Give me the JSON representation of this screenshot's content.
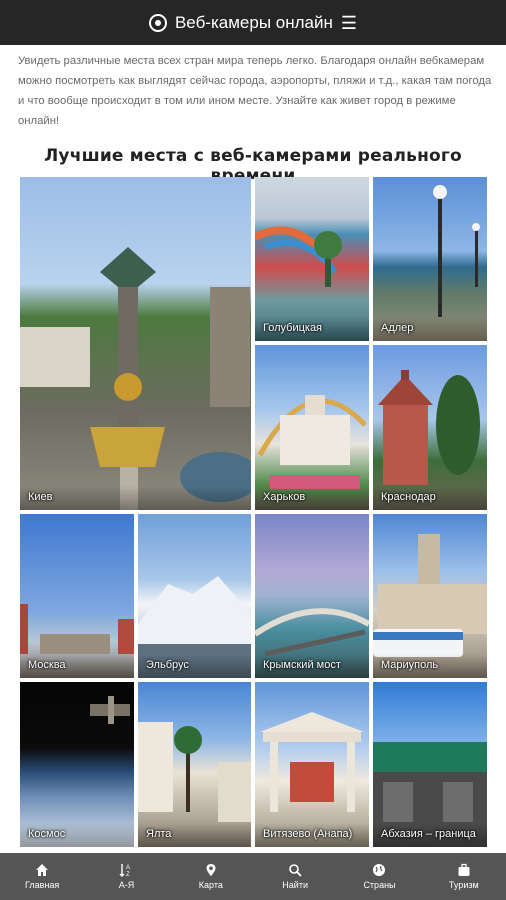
{
  "header": {
    "title": "Веб-камеры онлайн",
    "menu_icon": "hamburger-icon",
    "logo_icon": "webcam-icon"
  },
  "intro": "Увидеть различные места всех стран мира теперь легко. Благодаря онлайн вебкамерам можно посмотреть как выглядят сейчас города, аэропорты, пляжи и т.д., какая там погода и что вообще происходит в том или ином месте. Узнайте как живет город в режиме онлайн!",
  "section_title": "Лучшие места с веб-камерами реального времени",
  "tiles": [
    {
      "label": "Киев"
    },
    {
      "label": "Голубицкая"
    },
    {
      "label": "Адлер"
    },
    {
      "label": "Харьков"
    },
    {
      "label": "Краснодар"
    },
    {
      "label": "Москва"
    },
    {
      "label": "Эльбрус"
    },
    {
      "label": "Крымский мост"
    },
    {
      "label": "Мариуполь"
    },
    {
      "label": "Космос"
    },
    {
      "label": "Ялта"
    },
    {
      "label": "Витязево (Анапа)"
    },
    {
      "label": "Абхазия – граница"
    }
  ],
  "nav": [
    {
      "label": "Главная",
      "icon": "home-icon"
    },
    {
      "label": "А-Я",
      "icon": "sort-alpha-icon"
    },
    {
      "label": "Карта",
      "icon": "map-pin-icon"
    },
    {
      "label": "Найти",
      "icon": "search-icon"
    },
    {
      "label": "Страны",
      "icon": "globe-icon"
    },
    {
      "label": "Туризм",
      "icon": "suitcase-icon"
    }
  ]
}
